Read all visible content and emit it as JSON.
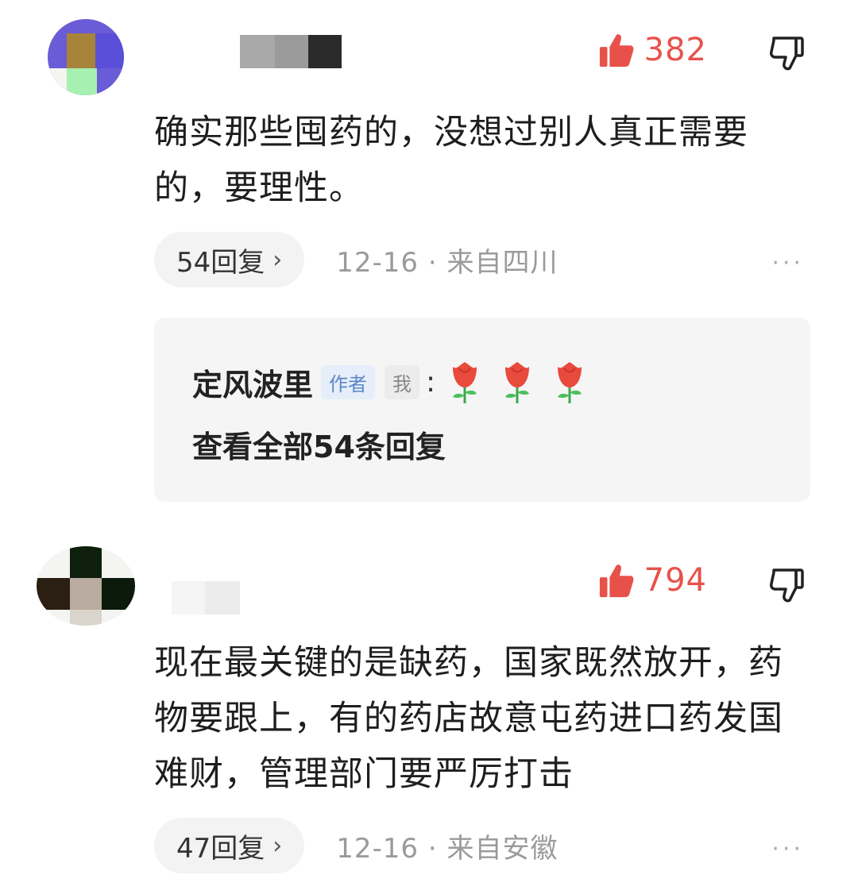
{
  "comments": [
    {
      "likes": "382",
      "text": "确实那些囤药的，没想过别人真正需要的，要理性。",
      "reply_label": "54回复",
      "date": "12-16",
      "location": "来自四川",
      "meta_separator": "·",
      "more": "···",
      "replies_preview": {
        "author": "定风波里",
        "author_tag": "作者",
        "me_tag": "我",
        "colon": ":",
        "emoji": [
          "rose-icon",
          "rose-icon",
          "rose-icon"
        ],
        "view_all": "查看全部54条回复"
      }
    },
    {
      "likes": "794",
      "text": "现在最关键的是缺药，国家既然放开，药物要跟上，有的药店故意屯药进口药发国难财，管理部门要严厉打击",
      "reply_label": "47回复",
      "date": "12-16",
      "location": "来自安徽",
      "meta_separator": "·",
      "more": "···"
    }
  ],
  "icons": {
    "like": "thumbs-up-icon",
    "dislike": "thumbs-down-icon",
    "chevron": "chevron-right-icon"
  },
  "colors": {
    "like_red": "#e8514a",
    "meta_gray": "#9a9a9a",
    "pill_bg": "#f3f3f3",
    "reply_box_bg": "#f5f5f5",
    "author_tag_blue": "#5b87c9"
  }
}
